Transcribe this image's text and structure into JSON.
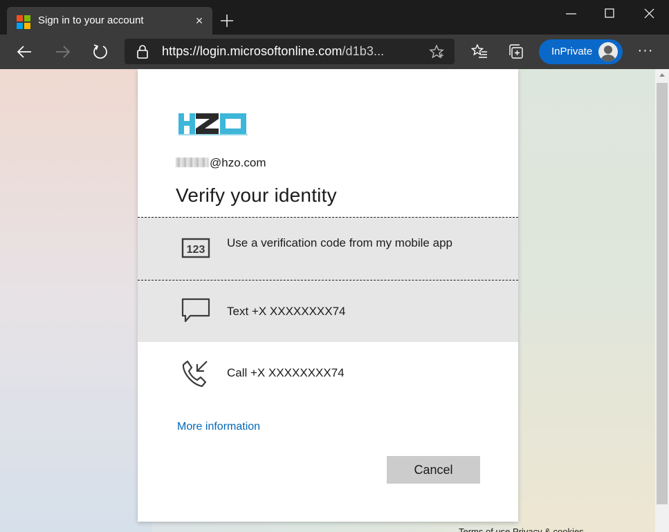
{
  "browser": {
    "tab_title": "Sign in to your account",
    "tab_close": "×",
    "url_scheme": "https://",
    "url_host": "login.microsoftonline.com",
    "url_rest": "/d1b3...",
    "inprivate_label": "InPrivate",
    "more_label": "···",
    "favicon_colors": [
      "#f25022",
      "#7fba00",
      "#00a4ef",
      "#ffb900"
    ],
    "accent": "#0a68c9"
  },
  "signin": {
    "logo_alt": "HZO",
    "email_suffix": "@hzo.com",
    "heading": "Verify your identity",
    "options": [
      {
        "label": "Use a verification code from my mobile app",
        "icon": "verification-code-icon"
      },
      {
        "label": "Text +X XXXXXXXX74",
        "icon": "chat-bubble-icon"
      },
      {
        "label": "Call +X XXXXXXXX74",
        "icon": "phone-call-icon"
      }
    ],
    "more_info": "More information",
    "cancel_label": "Cancel",
    "footer_text": "Terms of use    Privacy & cookies",
    "link_color": "#0067b8"
  }
}
